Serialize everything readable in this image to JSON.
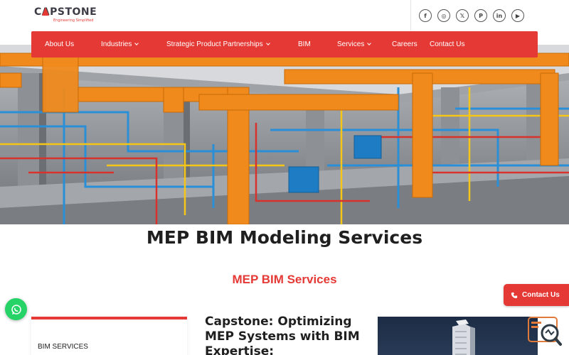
{
  "brand": {
    "name": "CAPSTONE",
    "tagline": "Engineering Simplified",
    "accent_color": "#e53935"
  },
  "socials": [
    {
      "icon": "facebook-icon",
      "glyph": "f"
    },
    {
      "icon": "instagram-icon",
      "glyph": "◎"
    },
    {
      "icon": "x-icon",
      "glyph": "𝕏"
    },
    {
      "icon": "pinterest-icon",
      "glyph": "P"
    },
    {
      "icon": "linkedin-icon",
      "glyph": "in"
    },
    {
      "icon": "youtube-icon",
      "glyph": "▶"
    }
  ],
  "nav": {
    "items": [
      {
        "label": "About Us",
        "dropdown": false
      },
      {
        "label": "Industries",
        "dropdown": true
      },
      {
        "label": "Strategic Product Partnerships",
        "dropdown": true
      },
      {
        "label": "BIM",
        "dropdown": false
      },
      {
        "label": "Services",
        "dropdown": true
      },
      {
        "label": "Careers",
        "dropdown": false
      },
      {
        "label": "Contact Us",
        "dropdown": false
      }
    ]
  },
  "hero": {
    "image": "mep-bim-3d-model-image"
  },
  "page_title": "MEP BIM Modeling Services",
  "section_heading": "MEP BIM Services",
  "sidebar": {
    "label": "BIM SERVICES"
  },
  "content": {
    "heading": "Capstone: Optimizing MEP Systems with BIM Expertise:"
  },
  "floating": {
    "contact_label": "Contact Us",
    "whatsapp_icon": "whatsapp-icon",
    "chat_icon": "chat-widget-icon"
  }
}
